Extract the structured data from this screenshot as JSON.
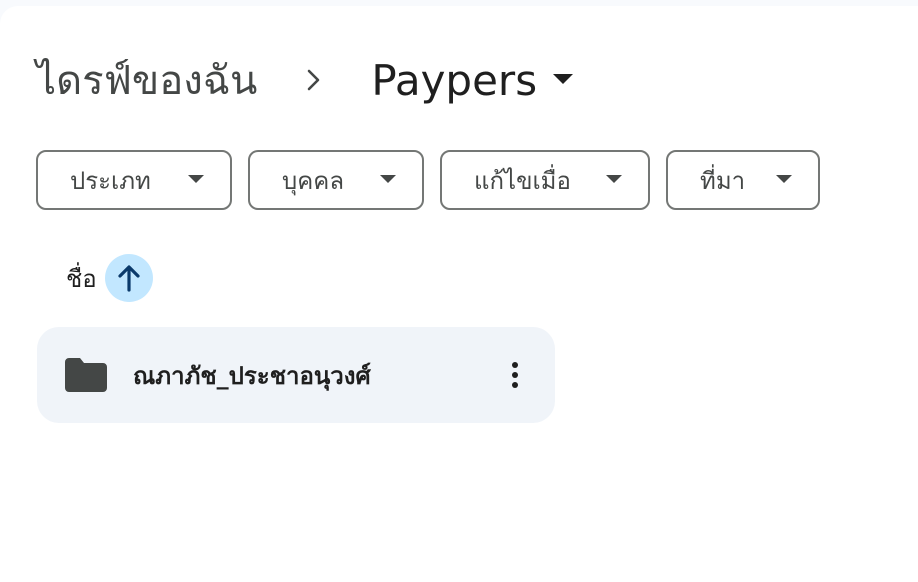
{
  "breadcrumb": {
    "root": "ไดรฟ์ของฉัน",
    "current": "Paypers",
    "separator_icon": "chevron-right-icon",
    "caret_icon": "caret-down-icon"
  },
  "filters": [
    {
      "label": "ประเภท",
      "icon": "caret-down-icon"
    },
    {
      "label": "บุคคล",
      "icon": "caret-down-icon"
    },
    {
      "label": "แก้ไขเมื่อ",
      "icon": "caret-down-icon"
    },
    {
      "label": "ที่มา",
      "icon": "caret-down-icon"
    }
  ],
  "sort": {
    "label": "ชื่อ",
    "direction": "ascending",
    "icon": "arrow-up-icon"
  },
  "files": [
    {
      "name": "ณภาภัช_ประชาอนุวงศ์",
      "type": "folder",
      "icon": "folder-icon",
      "menu_icon": "more-vert-icon"
    }
  ],
  "colors": {
    "background": "#f8fafd",
    "panel": "#ffffff",
    "chip_border": "#747775",
    "sort_highlight": "#c2e7ff",
    "sort_arrow": "#0b57d0",
    "row_background": "#f0f4f9",
    "folder": "#444746"
  }
}
